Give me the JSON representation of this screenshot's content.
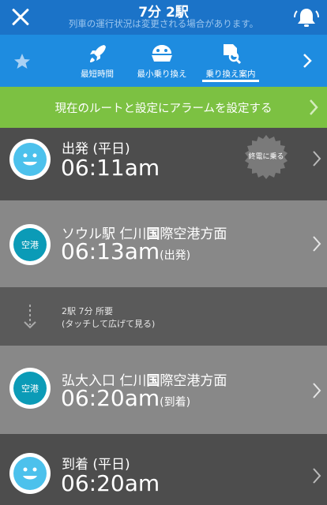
{
  "header": {
    "title": "7分 2駅",
    "subtitle": "列車の運行状況は変更される場合があります。"
  },
  "tabs": [
    {
      "label": "最短時間",
      "icon": "rocket-icon",
      "active": false
    },
    {
      "label": "最小乗り換え",
      "icon": "bowl-icon",
      "active": false
    },
    {
      "label": "乗り換え案内",
      "icon": "document-search-icon",
      "active": true
    }
  ],
  "alarm": {
    "label": "現在のルートと設定にアラームを設定する"
  },
  "rows": [
    {
      "label": "出発 (平日)",
      "time": "06:11am",
      "suffix": "",
      "icon": "smiley-face-icon"
    },
    {
      "label_a": "ソウル駅",
      "label_b": " 仁川",
      "label_c": "国",
      "label_d": "際空港方面",
      "time": "06:13am",
      "suffix": "(出発)",
      "icon_text": "空港"
    },
    {
      "label_a": "弘大入口",
      "label_b": " 仁川",
      "label_c": "国",
      "label_d": "際空港方面",
      "time": "06:20am",
      "suffix": "(到着)",
      "icon_text": "空港"
    },
    {
      "label": "到着 (平日)",
      "time": "06:20am",
      "suffix": "",
      "icon": "smiley-face-icon"
    }
  ],
  "badge": {
    "label": "終電に乗る"
  },
  "transfer": {
    "line1": "2駅 7分 所要",
    "line2": "(タッチして広げて見る)"
  },
  "colors": {
    "header": "#1b73c8",
    "tabbar": "#1e8ce0",
    "alarm": "#7cc142",
    "dark_row": "#4d4d4d",
    "light_row": "#888888",
    "face": "#4cc1ec",
    "airport": "#0b9bb7"
  }
}
